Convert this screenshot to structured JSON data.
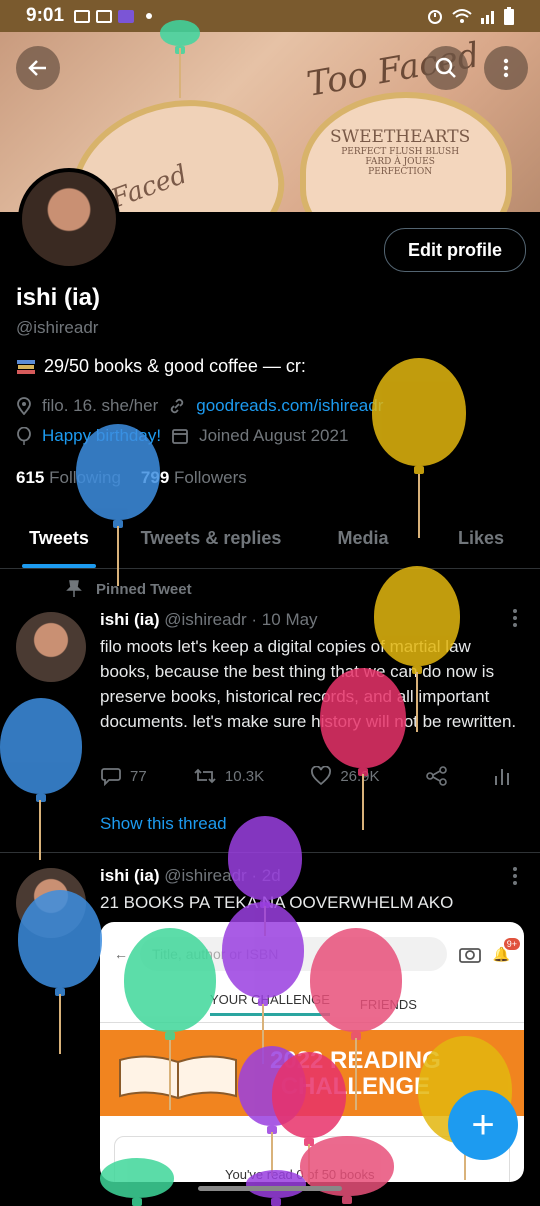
{
  "status_bar": {
    "time": "9:01"
  },
  "banner": {
    "brand_text": "Too Faced",
    "product_text": "SWEETHEARTS",
    "product_sub": "PERFECT FLUSH BLUSH",
    "product_sub2": "FARD À JOUES",
    "product_sub3": "PERFECTION",
    "faced_text": "Faced"
  },
  "profile": {
    "edit_label": "Edit profile",
    "name": "ishi (ia)",
    "handle": "@ishireadr",
    "bio": "29/50 books & good coffee — cr:",
    "location": "filo. 16. she/her",
    "website": "goodreads.com/ishireadr",
    "birthday": "Happy birthday!",
    "joined": "Joined August 2021",
    "following_count": "615",
    "following_label": "Following",
    "followers_count": "799",
    "followers_label": "Followers"
  },
  "tabs": [
    {
      "label": "Tweets"
    },
    {
      "label": "Tweets & replies"
    },
    {
      "label": "Media"
    },
    {
      "label": "Likes"
    }
  ],
  "tweets": [
    {
      "pinned_label": "Pinned Tweet",
      "name": "ishi (ia)",
      "handle_time": "@ishireadr · 10 May",
      "text": "filo moots let's keep a digital copies of martial law books, because the best thing that we can do now is preserve books, historical records, and all important documents. let's make sure history will not be rewritten.",
      "replies": "77",
      "retweets": "10.3K",
      "likes": "26.9K",
      "thread_label": "Show this thread"
    },
    {
      "name": "ishi (ia)",
      "handle_time": "@ishireadr · 2d",
      "text": "21 BOOKS PA TEKA NA OOVERWHELM AKO"
    }
  ],
  "embed": {
    "search_placeholder": "Title, author or ISBN",
    "tab1": "YOUR CHALLENGE",
    "tab2": "FRIENDS",
    "title_line1": "2022 READING",
    "title_line2": "CHALLENGE",
    "card_text": "You've read 0 of 50 books",
    "badge": "9+"
  },
  "fab_label": "+",
  "colors": {
    "accent": "#1d9bf0",
    "background": "#000000",
    "muted": "#71767b",
    "statusbar": "#7a5a2e"
  }
}
